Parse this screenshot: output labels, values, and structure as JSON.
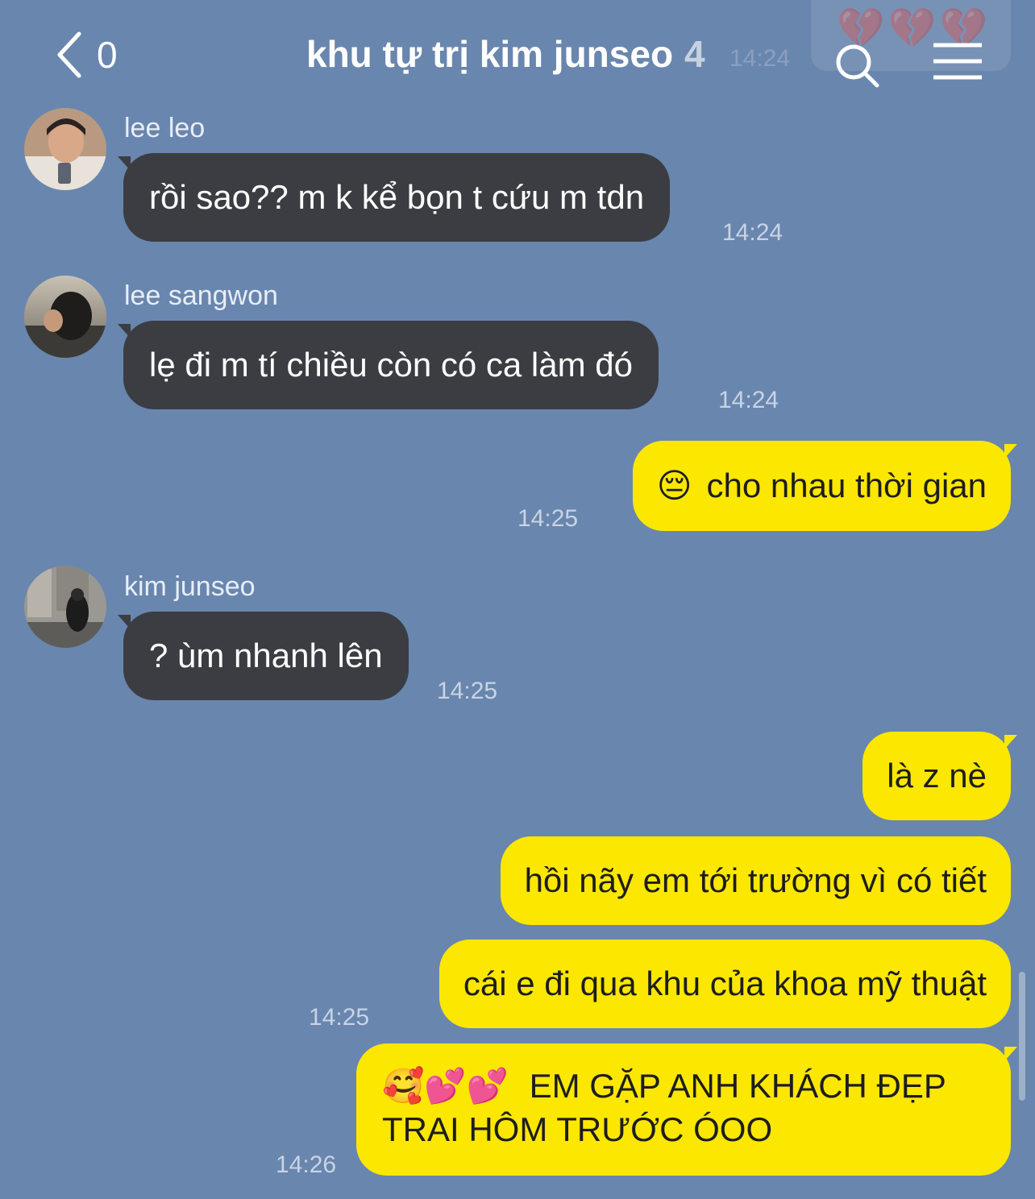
{
  "header": {
    "back_count": "0",
    "title": "khu tự trị kim junseo",
    "member_count": "4",
    "ghost_time": "14:24"
  },
  "notification": {
    "icons": "💔💔💔"
  },
  "messages": [
    {
      "type": "incoming",
      "sender": "lee leo",
      "text": "rồi sao?? m k kể bọn t cứu m tdn",
      "time": "14:24"
    },
    {
      "type": "incoming",
      "sender": "lee sangwon",
      "text": "lẹ đi m tí chiều còn có ca làm đó",
      "time": "14:24"
    },
    {
      "type": "outgoing",
      "emoji": "😔",
      "text": "cho nhau thời gian",
      "time": "14:25"
    },
    {
      "type": "incoming",
      "sender": "kim junseo",
      "text": "? ùm nhanh lên",
      "time": "14:25"
    },
    {
      "type": "outgoing",
      "text": "là z nè"
    },
    {
      "type": "outgoing",
      "text": "hồi nãy em tới trường vì có tiết"
    },
    {
      "type": "outgoing",
      "text": "cái e đi qua khu của khoa mỹ thuật",
      "time": "14:25"
    },
    {
      "type": "outgoing",
      "emoji": "🥰💕💕",
      "text": "EM GẶP ANH KHÁCH ĐẸP",
      "text2": "TRAI HÔM TRƯỚC ÓOO",
      "time": "14:26"
    }
  ],
  "colors": {
    "background": "#6986ae",
    "incoming_bubble": "#3b3d42",
    "outgoing_bubble": "#fce700"
  }
}
